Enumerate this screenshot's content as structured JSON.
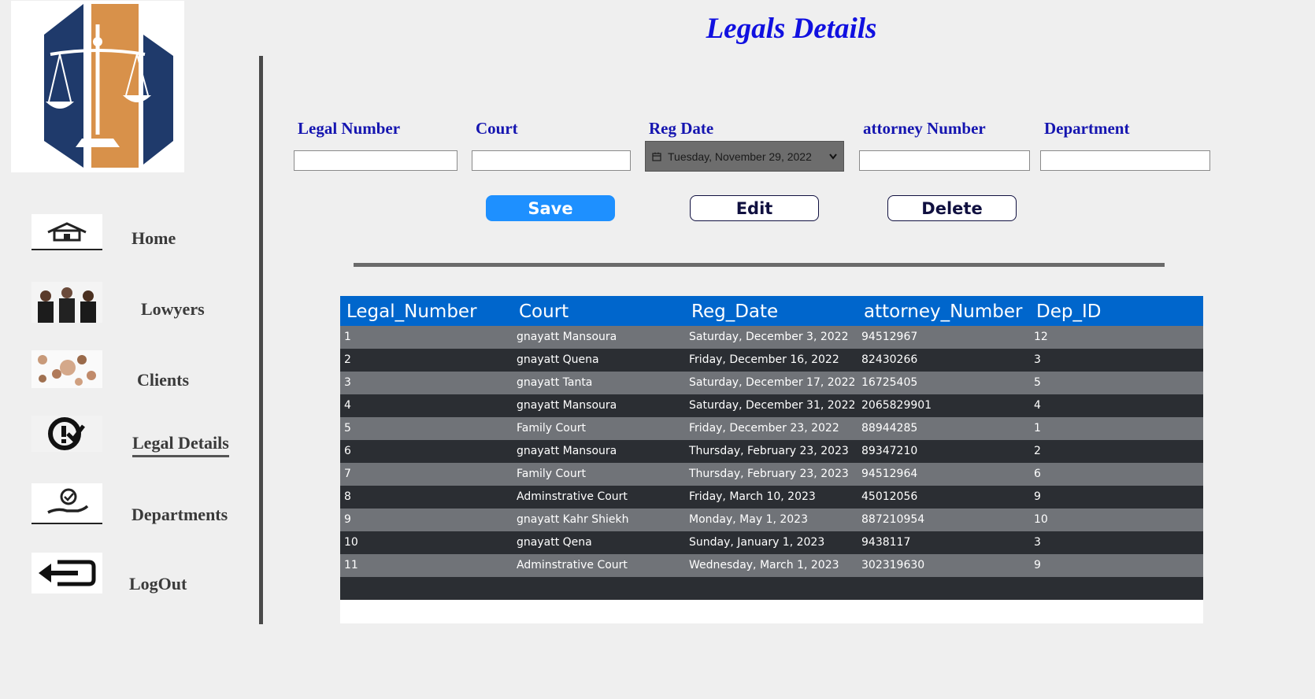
{
  "app": {
    "title": "Legals Details"
  },
  "sidebar": {
    "items": [
      {
        "label": "Home",
        "icon": "house-icon"
      },
      {
        "label": "Lowyers",
        "icon": "lawyers-photo-icon"
      },
      {
        "label": "Clients",
        "icon": "clients-photo-icon"
      },
      {
        "label": "Legal Details",
        "icon": "legal-check-icon",
        "active": true
      },
      {
        "label": "Departments",
        "icon": "hand-badge-icon"
      },
      {
        "label": "LogOut",
        "icon": "logout-arrow-icon"
      }
    ]
  },
  "form": {
    "legal_number_label": "Legal Number",
    "court_label": "Court",
    "reg_date_label": "Reg Date",
    "attorney_number_label": "attorney Number",
    "department_label": "Department",
    "legal_number_value": "",
    "court_value": "",
    "reg_date_value": "Tuesday, November 29, 2022",
    "attorney_number_value": "",
    "department_value": ""
  },
  "buttons": {
    "save": "Save",
    "edit": "Edit",
    "delete": "Delete"
  },
  "table": {
    "columns": [
      "Legal_Number",
      "Court",
      "Reg_Date",
      "attorney_Number",
      "Dep_ID"
    ],
    "rows": [
      [
        "1",
        "gnayatt Mansoura",
        "Saturday, December 3, 2022",
        "94512967",
        "12"
      ],
      [
        "2",
        "gnayatt Quena",
        "Friday, December 16, 2022",
        "82430266",
        "3"
      ],
      [
        "3",
        "gnayatt Tanta",
        "Saturday, December 17, 2022",
        "16725405",
        "5"
      ],
      [
        "4",
        "gnayatt Mansoura",
        "Saturday, December 31, 2022",
        "2065829901",
        "4"
      ],
      [
        "5",
        "Family Court",
        "Friday, December 23, 2022",
        "88944285",
        "1"
      ],
      [
        "6",
        "gnayatt Mansoura",
        "Thursday, February 23, 2023",
        "89347210",
        "2"
      ],
      [
        "7",
        "Family Court",
        "Thursday, February 23, 2023",
        "94512964",
        "6"
      ],
      [
        "8",
        "Adminstrative Court",
        "Friday, March 10, 2023",
        "45012056",
        "9"
      ],
      [
        "9",
        "gnayatt Kahr Shiekh",
        "Monday, May 1, 2023",
        "887210954",
        "10"
      ],
      [
        "10",
        "gnayatt Qena",
        "Sunday, January 1, 2023",
        "9438117",
        "3"
      ],
      [
        "11",
        "Adminstrative Court",
        "Wednesday, March 1, 2023",
        "302319630",
        "9"
      ]
    ]
  },
  "colors": {
    "accent": "#1e90ff",
    "header_blue": "#0066cc",
    "title_blue": "#1010e0",
    "label_blue": "#1515b0",
    "logo_navy": "#1f3a6b",
    "logo_orange": "#d8914a"
  }
}
